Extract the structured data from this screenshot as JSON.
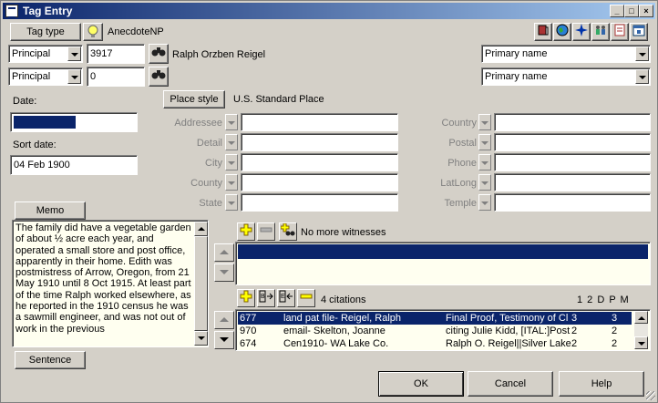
{
  "window": {
    "title": "Tag Entry"
  },
  "toolbar": {
    "tag_type_label": "Tag type",
    "tag_name": "AnecdoteNP",
    "icons": [
      "book-icon",
      "globe-icon",
      "compass-icon",
      "people-icon",
      "clipboard-icon",
      "calendar-icon"
    ]
  },
  "principal1": {
    "role": "Principal",
    "id": "3917",
    "name": "Ralph Orzben Reigel",
    "name_type": "Primary name"
  },
  "principal2": {
    "role": "Principal",
    "id": "0",
    "name": "",
    "name_type": "Primary name"
  },
  "date": {
    "label": "Date:",
    "value": ""
  },
  "sort_date": {
    "label": "Sort date:",
    "value": "04 Feb 1900"
  },
  "place": {
    "button_label": "Place style",
    "style_value": "U.S. Standard Place",
    "left_fields": [
      "Addressee",
      "Detail",
      "City",
      "County",
      "State"
    ],
    "right_fields": [
      "Country",
      "Postal",
      "Phone",
      "LatLong",
      "Temple"
    ]
  },
  "memo": {
    "button_label": "Memo",
    "text": "The family did have a vegetable garden of about ½ acre each year, and operated a small store and post office, apparently in their home. Edith was postmistress of Arrow, Oregon, from 21 May 1910 until 8 Oct 1915. At least part of the time Ralph worked elsewhere, as he reported in the 1910 census he was a sawmill engineer, and was not out of work in the previous"
  },
  "sentence_label": "Sentence",
  "witnesses": {
    "status": "No more witnesses"
  },
  "citations": {
    "count_label": "4  citations",
    "header": "1 2 D P M",
    "rows": [
      {
        "id": "677",
        "source": "land pat file- Reigel, Ralph",
        "detail": "Final Proof, Testimony of Cl",
        "q": "3",
        "q2": "3"
      },
      {
        "id": "970",
        "source": "email- Skelton, Joanne",
        "detail": "citing Julie Kidd, [ITAL:]Post",
        "q": "2",
        "q2": "2"
      },
      {
        "id": "674",
        "source": "Cen1910- WA Lake Co.",
        "detail": "Ralph O. Reigel||Silver Lake",
        "q": "2",
        "q2": "2"
      }
    ]
  },
  "buttons": {
    "ok": "OK",
    "cancel": "Cancel",
    "help": "Help"
  },
  "colors": {
    "selection": "#0a246a",
    "window_bg": "#d4d0c8"
  }
}
